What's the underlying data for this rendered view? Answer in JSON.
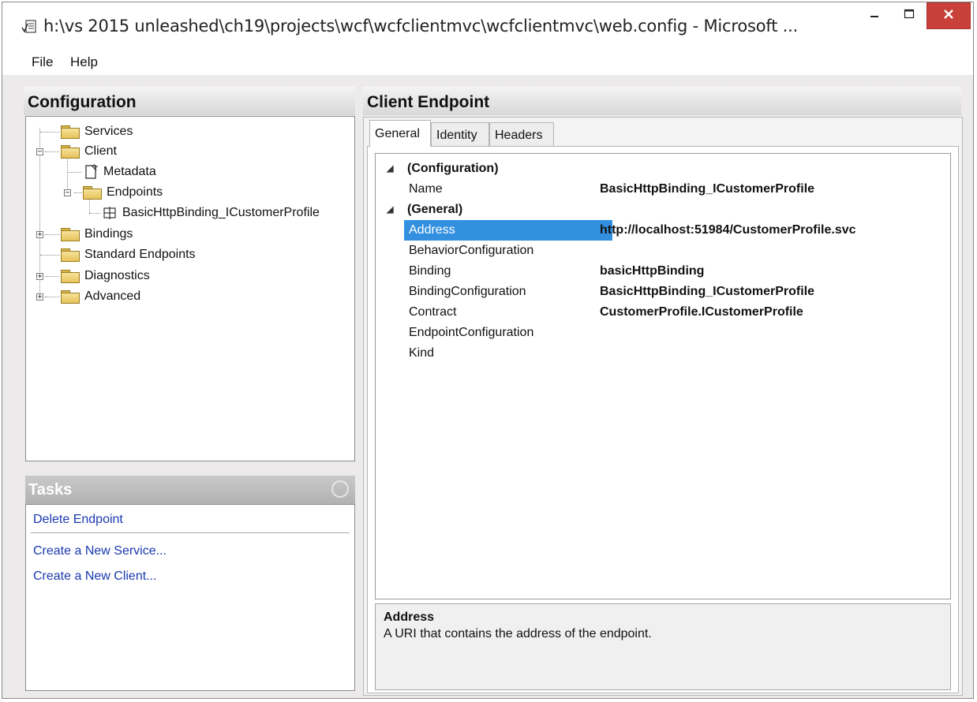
{
  "window": {
    "title": "h:\\vs 2015 unleashed\\ch19\\projects\\wcf\\wcfclientmvc\\wcfclientmvc\\web.config - Microsoft ...",
    "app_icon": "checkmark-document-icon",
    "controls": {
      "minimize": "minimize-icon",
      "maximize": "maximize-icon",
      "close": "close-icon"
    },
    "close_color": "#c9403a"
  },
  "menu": {
    "file": "File",
    "help": "Help"
  },
  "configuration_panel": {
    "title": "Configuration",
    "tree": [
      {
        "label": "Services",
        "icon": "folder-icon"
      },
      {
        "label": "Client",
        "icon": "folder-icon",
        "expanded": true
      },
      {
        "label": "Metadata",
        "icon": "metadata-document-icon"
      },
      {
        "label": "Endpoints",
        "icon": "folder-icon",
        "expanded": true
      },
      {
        "label": "BasicHttpBinding_ICustomerProfile",
        "icon": "endpoint-icon"
      },
      {
        "label": "Bindings",
        "icon": "folder-icon",
        "expanded": false
      },
      {
        "label": "Standard Endpoints",
        "icon": "folder-icon"
      },
      {
        "label": "Diagnostics",
        "icon": "folder-icon",
        "expanded": false
      },
      {
        "label": "Advanced",
        "icon": "folder-icon",
        "expanded": false
      }
    ]
  },
  "tasks_panel": {
    "title": "Tasks",
    "links": [
      "Delete Endpoint",
      "Create a New Service...",
      "Create a New Client..."
    ]
  },
  "client_endpoint": {
    "title": "Client Endpoint",
    "tabs": [
      "General",
      "Identity",
      "Headers"
    ],
    "active_tab": "General",
    "categories": [
      {
        "name": "(Configuration)",
        "properties": [
          {
            "name": "Name",
            "value": "BasicHttpBinding_ICustomerProfile"
          }
        ]
      },
      {
        "name": "(General)",
        "properties": [
          {
            "name": "Address",
            "value": "http://localhost:51984/CustomerProfile.svc",
            "selected": true
          },
          {
            "name": "BehaviorConfiguration",
            "value": ""
          },
          {
            "name": "Binding",
            "value": "basicHttpBinding"
          },
          {
            "name": "BindingConfiguration",
            "value": "BasicHttpBinding_ICustomerProfile"
          },
          {
            "name": "Contract",
            "value": "CustomerProfile.ICustomerProfile"
          },
          {
            "name": "EndpointConfiguration",
            "value": ""
          },
          {
            "name": "Kind",
            "value": ""
          }
        ]
      }
    ],
    "description": {
      "title": "Address",
      "text": "A URI that contains the address of the endpoint."
    },
    "selection_color": "#3390e0"
  }
}
